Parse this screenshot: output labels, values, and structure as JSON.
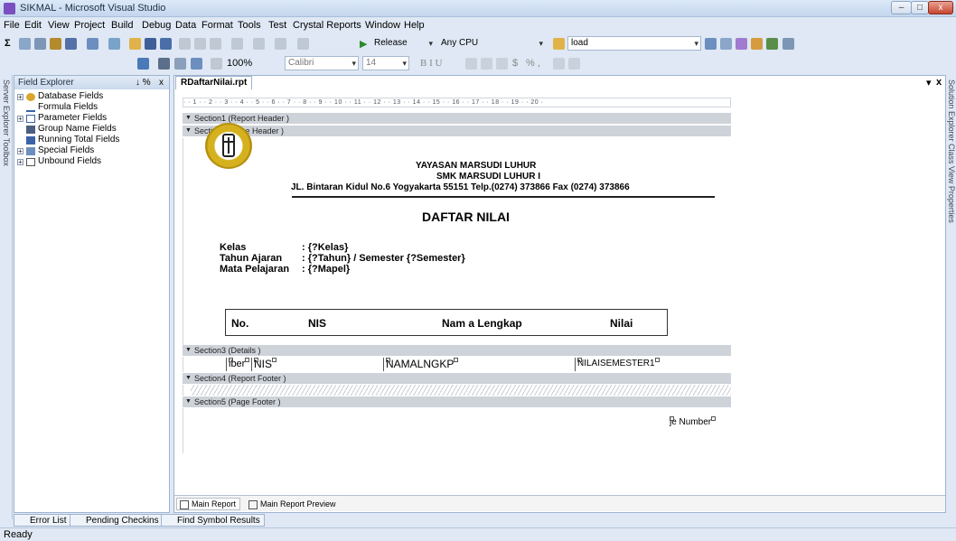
{
  "window": {
    "title": "SIKMAL - Microsoft Visual Studio",
    "min": "–",
    "max": "□",
    "close": "x"
  },
  "menu": [
    "File",
    "Edit",
    "View",
    "Project",
    "Build",
    "Debug",
    "Data",
    "Format",
    "Tools",
    "Test",
    "Crystal Reports",
    "Window",
    "Help"
  ],
  "toolbar": {
    "config": "Release",
    "platform": "Any CPU",
    "find": "load",
    "zoom": "100%",
    "font": "Calibri",
    "fontsize": "14",
    "format_buttons": "B  I  U",
    "number_buttons": "% ,"
  },
  "side_tabs": {
    "left": "Server Explorer  Toolbox",
    "right": "Solution Explorer  Class View   Properties"
  },
  "field_explorer": {
    "title": "Field Explorer",
    "pin": "↓ %",
    "close": "x",
    "items": [
      "Database Fields",
      "Formula Fields",
      "Parameter Fields",
      "Group Name Fields",
      "Running Total Fields",
      "Special Fields",
      "Unbound Fields"
    ]
  },
  "document": {
    "tab": "RDaftarNilai.rpt",
    "close": "x",
    "ruler": "· · 1 · · 2 · · 3 · · 4 · · 5 · · 6 · · 7 · · 8 · · 9 · · 10 · · 11 · · 12 · · 13 · · 14 · · 15 · · 16 · · 17 · · 18 · · 19 · · 20 ·",
    "sections": [
      "Section1 (Report Header )",
      "Section2 (Page Header )",
      "Section3 (Details )",
      "Section4 (Report Footer )",
      "Section5 (Page Footer )"
    ],
    "report": {
      "org1": "YAYASAN MARSUDI LUHUR",
      "org2": "SMK MARSUDI LUHUR I",
      "address": "JL. Bintaran Kidul No.6 Yogyakarta 55151 Telp.(0274) 373866 Fax (0274) 373866",
      "title": "DAFTAR NILAI",
      "labels": [
        "Kelas",
        "Tahun Ajaran",
        "Mata Pelajaran"
      ],
      "values": [
        ": {?Kelas}",
        ": {?Tahun} / Semester {?Semester}",
        ": {?Mapel}"
      ],
      "headers": [
        "No.",
        "NIS",
        "Nam a Lengkap",
        "Nilai"
      ],
      "details": [
        "iber",
        "NIS",
        "NAMALNGKP",
        "NILAISEMESTER1"
      ],
      "page_number": "je Number"
    },
    "bottom_tabs": [
      "Main Report",
      "Main Report Preview"
    ]
  },
  "panes": [
    "Error List",
    "Pending Checkins",
    "Find Symbol Results"
  ],
  "status": "Ready",
  "colors": {
    "chrome": "#dfe8f4",
    "section_bar": "#ced3da",
    "logo_gold": "#d6b11e"
  }
}
